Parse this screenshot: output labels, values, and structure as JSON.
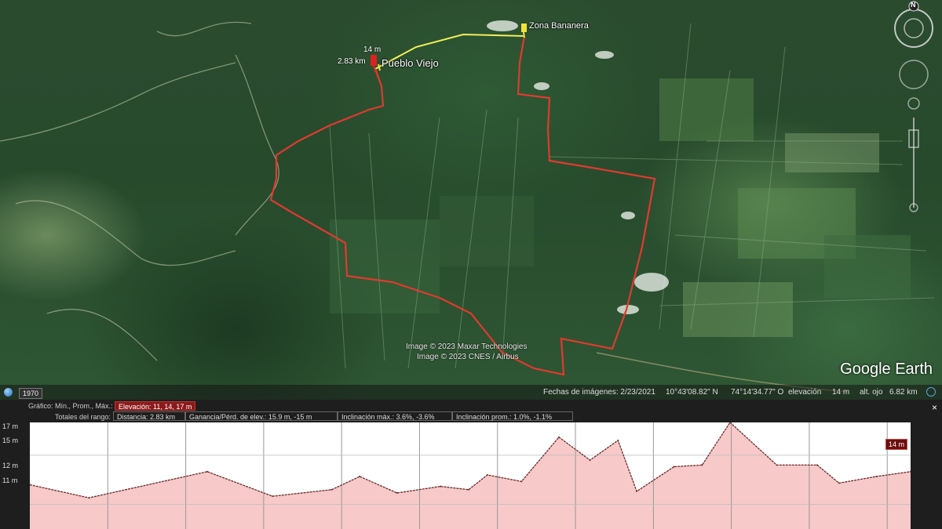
{
  "map": {
    "placemarks": [
      {
        "name": "Pueblo Viejo",
        "color": "#e02020"
      },
      {
        "name": "Zona Bananera",
        "color": "#f2e33a"
      }
    ],
    "pin_elevation": "14 m",
    "pin_distance": "2.83 km",
    "credits": [
      "Image © 2023 Maxar Technologies",
      "Image © 2023 CNES / Airbus"
    ],
    "logo_text": "Google Earth",
    "compass_letter": "N",
    "route_color": "#e03a2f",
    "link_color": "#f0ee5a"
  },
  "statusbar": {
    "year": "1970",
    "imagery_date": "Fechas de imágenes: 2/23/2021",
    "lat": "10°43'08.82\" N",
    "lon": "74°14'34.77\" O",
    "elevation_label": "elevación",
    "elevation_value": "14 m",
    "eye_alt_label": "alt. ojo",
    "eye_alt_value": "6.82 km"
  },
  "profile": {
    "graph_label": "Gráfico: Mín., Prom., Máx.:",
    "elevation_summary": "Elevación: 11, 14, 17 m",
    "range_totals_label": "Totales del rango:",
    "distance": "Distancia: 2.83 km",
    "gain_loss": "Ganancia/Pérd. de elev.: 15.9 m, -15 m",
    "max_slope": "Inclinación máx.: 3.6%, -3.6%",
    "avg_slope": "Inclinación prom.: 1.0%, -1.1%",
    "close_symbol": "×",
    "y_ticks": [
      "17 m",
      "15 m",
      "12 m",
      "11 m"
    ],
    "marker_value": "14 m",
    "fill_color": "#f7c9c9"
  },
  "chart_data": {
    "type": "area",
    "x": [
      0.0,
      0.19,
      0.57,
      0.78,
      0.97,
      1.06,
      1.18,
      1.32,
      1.41,
      1.47,
      1.58,
      1.7,
      1.8,
      1.89,
      1.95,
      2.07,
      2.16,
      2.25,
      2.4,
      2.53,
      2.6,
      2.72,
      2.83
    ],
    "y": [
      13.2,
      12.4,
      14.0,
      12.5,
      12.9,
      13.7,
      12.7,
      13.1,
      12.9,
      13.8,
      13.4,
      16.1,
      14.7,
      15.9,
      12.8,
      14.3,
      14.4,
      17.0,
      14.4,
      14.4,
      13.3,
      13.7,
      14.0
    ],
    "xlim": [
      0,
      2.83
    ],
    "ylim": [
      10.5,
      17
    ],
    "ylabel": "",
    "xlabel": "",
    "grid": true
  }
}
